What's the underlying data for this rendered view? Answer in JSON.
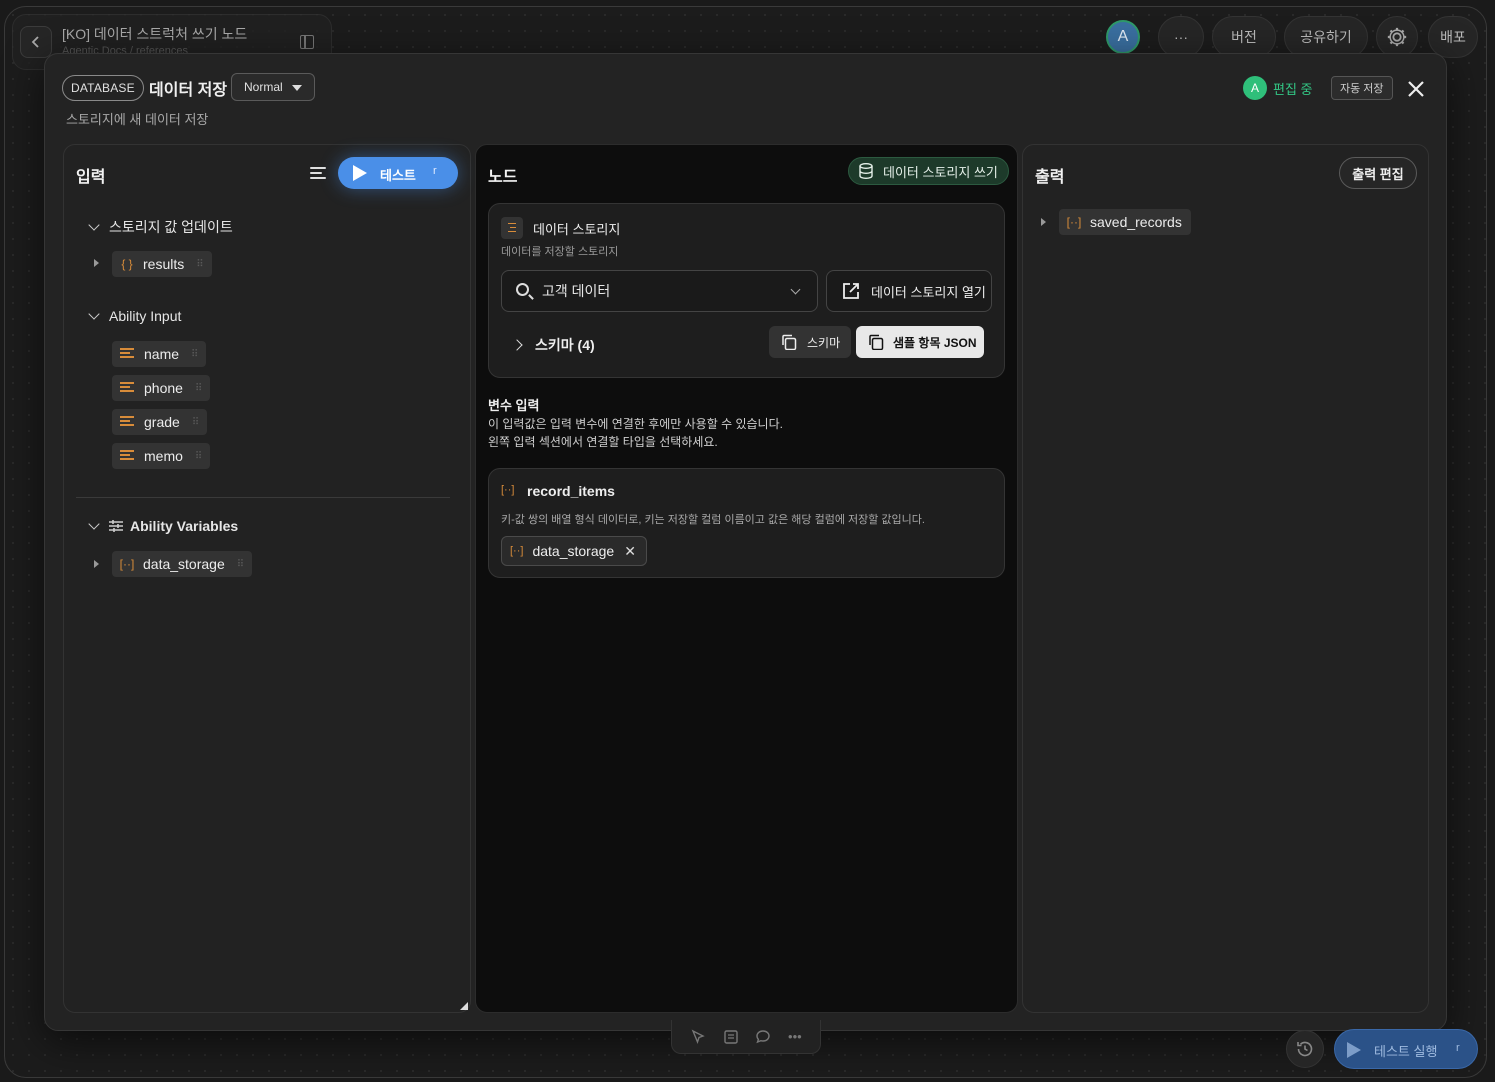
{
  "background": {
    "doc_title": "[KO] 데이터 스트럭처 쓰기 노드",
    "doc_subtitle": "Agentic Docs / references",
    "avatar_initial": "A",
    "more_label": "···",
    "version_label": "버전",
    "share_label": "공유하기",
    "deploy_label": "배포"
  },
  "modal": {
    "category_badge": "DATABASE",
    "title": "데이터 저장",
    "mode_value": "Normal",
    "description": "스토리지에 새 데이터 저장",
    "editor_initial": "A",
    "editing_status": "편집 중",
    "autosave_label": "자동 저장"
  },
  "input_panel": {
    "title": "입력",
    "test_label": "테스트",
    "test_shortcut": "r",
    "sections": [
      {
        "label": "스토리지 값 업데이트",
        "items": [
          {
            "label": "results",
            "icon": "braces-icon"
          }
        ]
      },
      {
        "label": "Ability Input",
        "items": [
          {
            "label": "name",
            "icon": "text-lines-icon"
          },
          {
            "label": "phone",
            "icon": "text-lines-icon"
          },
          {
            "label": "grade",
            "icon": "text-lines-icon"
          },
          {
            "label": "memo",
            "icon": "text-lines-icon"
          }
        ]
      },
      {
        "label": "Ability Variables",
        "items": [
          {
            "label": "data_storage",
            "icon": "brackets-icon"
          }
        ]
      }
    ]
  },
  "node_panel": {
    "title": "노드",
    "node_badge": "데이터 스토리지 쓰기",
    "storage_card": {
      "title": "데이터 스토리지",
      "subtitle": "데이터를 저장할 스토리지",
      "selected_storage": "고객 데이터",
      "open_button": "데이터 스토리지 열기",
      "schema_toggle": "스키마 (4)",
      "schema_button": "스키마",
      "sample_button": "샘플 항목 JSON"
    },
    "variable_input": {
      "title": "변수 입력",
      "desc_line1": "이 입력값은 입력 변수에 연결한 후에만 사용할 수 있습니다.",
      "desc_line2": "왼쪽 입력 섹션에서 연결할 타입을 선택하세요."
    },
    "record_card": {
      "title": "record_items",
      "description": "키-값 쌍의 배열 형식 데이터로, 키는 저장할 컬럼 이름이고 값은 해당 컬럼에 저장할 값입니다.",
      "bound_variable": "data_storage"
    }
  },
  "output_panel": {
    "title": "출력",
    "edit_button": "출력 편집",
    "items": [
      {
        "label": "saved_records",
        "icon": "brackets-icon"
      }
    ]
  },
  "footer": {
    "run_label": "테스트 실행",
    "run_shortcut": "r"
  },
  "colors": {
    "accent_blue": "#4a8fe8",
    "editing_green": "#33c785",
    "variable_orange": "#d88c3a"
  }
}
